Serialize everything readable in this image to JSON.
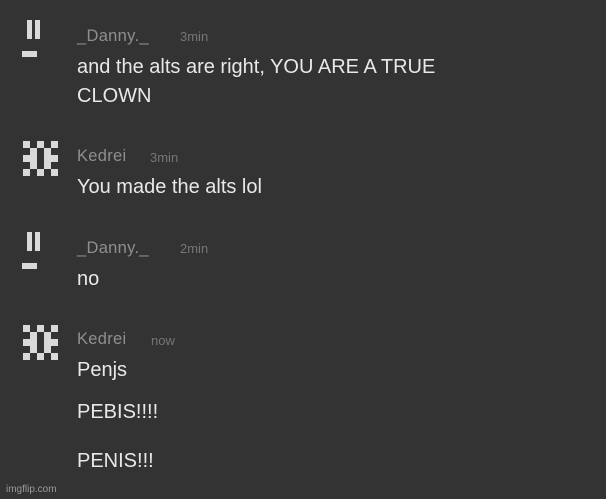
{
  "colors": {
    "background": "#333333",
    "username": "#8f8f8f",
    "timestamp": "#767676",
    "message_text": "#e8e8e8",
    "avatar": "#d9d9d9"
  },
  "messages": [
    {
      "author": "_Danny._",
      "avatar_icon": "exclamation-glyph-avatar-icon",
      "time": "3min",
      "lines": [
        "and the alts are right, YOU ARE A TRUE",
        "CLOWN"
      ]
    },
    {
      "author": "Kedrei",
      "avatar_icon": "pixel-pattern-avatar-icon",
      "time": "3min",
      "lines": [
        "You made the alts lol"
      ]
    },
    {
      "author": "_Danny._",
      "avatar_icon": "exclamation-glyph-avatar-icon",
      "time": "2min",
      "lines": [
        "no"
      ]
    },
    {
      "author": "Kedrei",
      "avatar_icon": "pixel-pattern-avatar-icon",
      "time": "now",
      "lines": [
        "Penjs",
        "PEBIS!!!!",
        "PENIS!!!"
      ]
    }
  ],
  "watermark": "imgflip.com"
}
